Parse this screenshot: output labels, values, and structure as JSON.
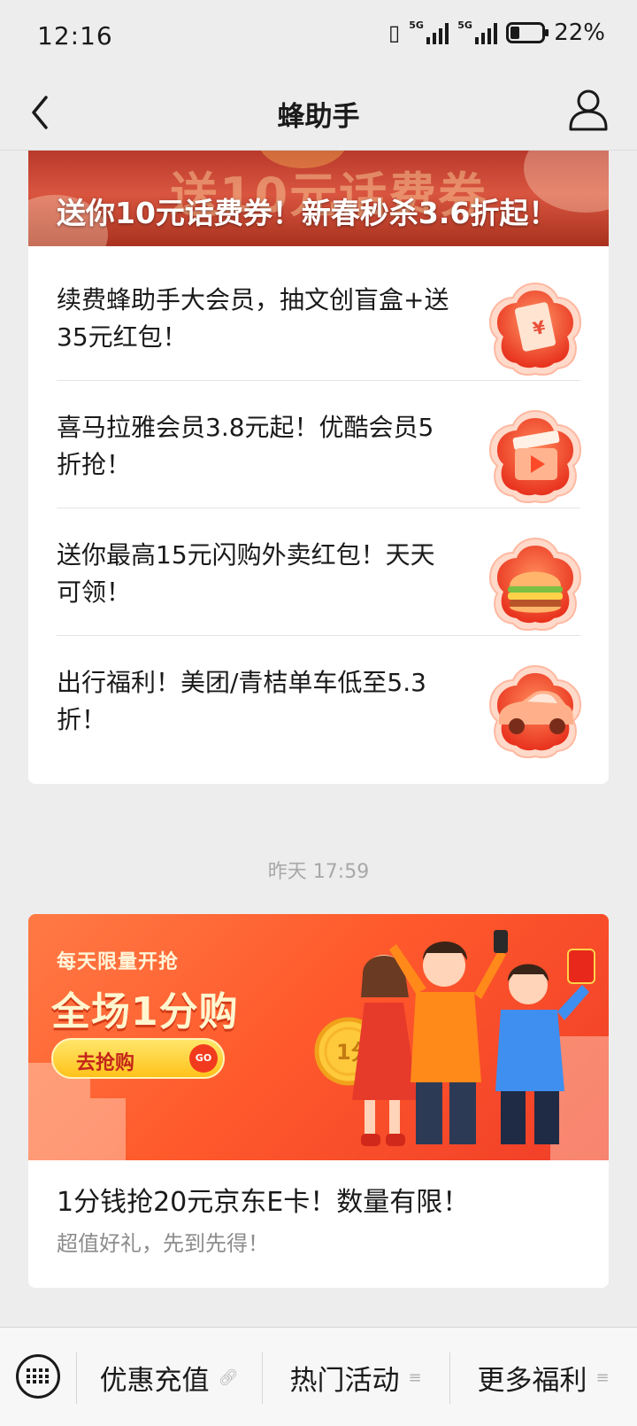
{
  "status_bar": {
    "time": "12:16",
    "battery": "22%",
    "network_1": "5G",
    "network_2": "5G"
  },
  "nav": {
    "title": "蜂助手"
  },
  "card1": {
    "banner_bg_text": "送10元话费券",
    "banner_text": "送你10元话费券！新春秒杀3.6折起！",
    "items": [
      {
        "text": "续费蜂助手大会员，抽文创盲盒+送35元红包！",
        "icon": "receipt-icon"
      },
      {
        "text": "喜马拉雅会员3.8元起！优酷会员5折抢！",
        "icon": "video-clapper-icon"
      },
      {
        "text": "送你最高15元闪购外卖红包！天天可领！",
        "icon": "burger-icon"
      },
      {
        "text": "出行福利！美团/青桔单车低至5.3折！",
        "icon": "car-icon"
      }
    ]
  },
  "timestamp": "昨天 17:59",
  "card2": {
    "banner_small": "每天限量开抢",
    "banner_big": "全场1分购",
    "banner_button": "去抢购",
    "banner_go": "GO",
    "coin_text": "1分",
    "title": "1分钱抢20元京东E卡！数量有限！",
    "subtitle": "超值好礼，先到先得！"
  },
  "bottom_menu": {
    "items": [
      {
        "label": "优惠充值",
        "icon": "link-icon"
      },
      {
        "label": "热门活动",
        "icon": "menu-icon"
      },
      {
        "label": "更多福利",
        "icon": "menu-icon"
      }
    ]
  },
  "colors": {
    "background": "#ededed",
    "card": "#ffffff",
    "banner_red": "#c8402f",
    "banner_orange": "#ff5a2c"
  }
}
